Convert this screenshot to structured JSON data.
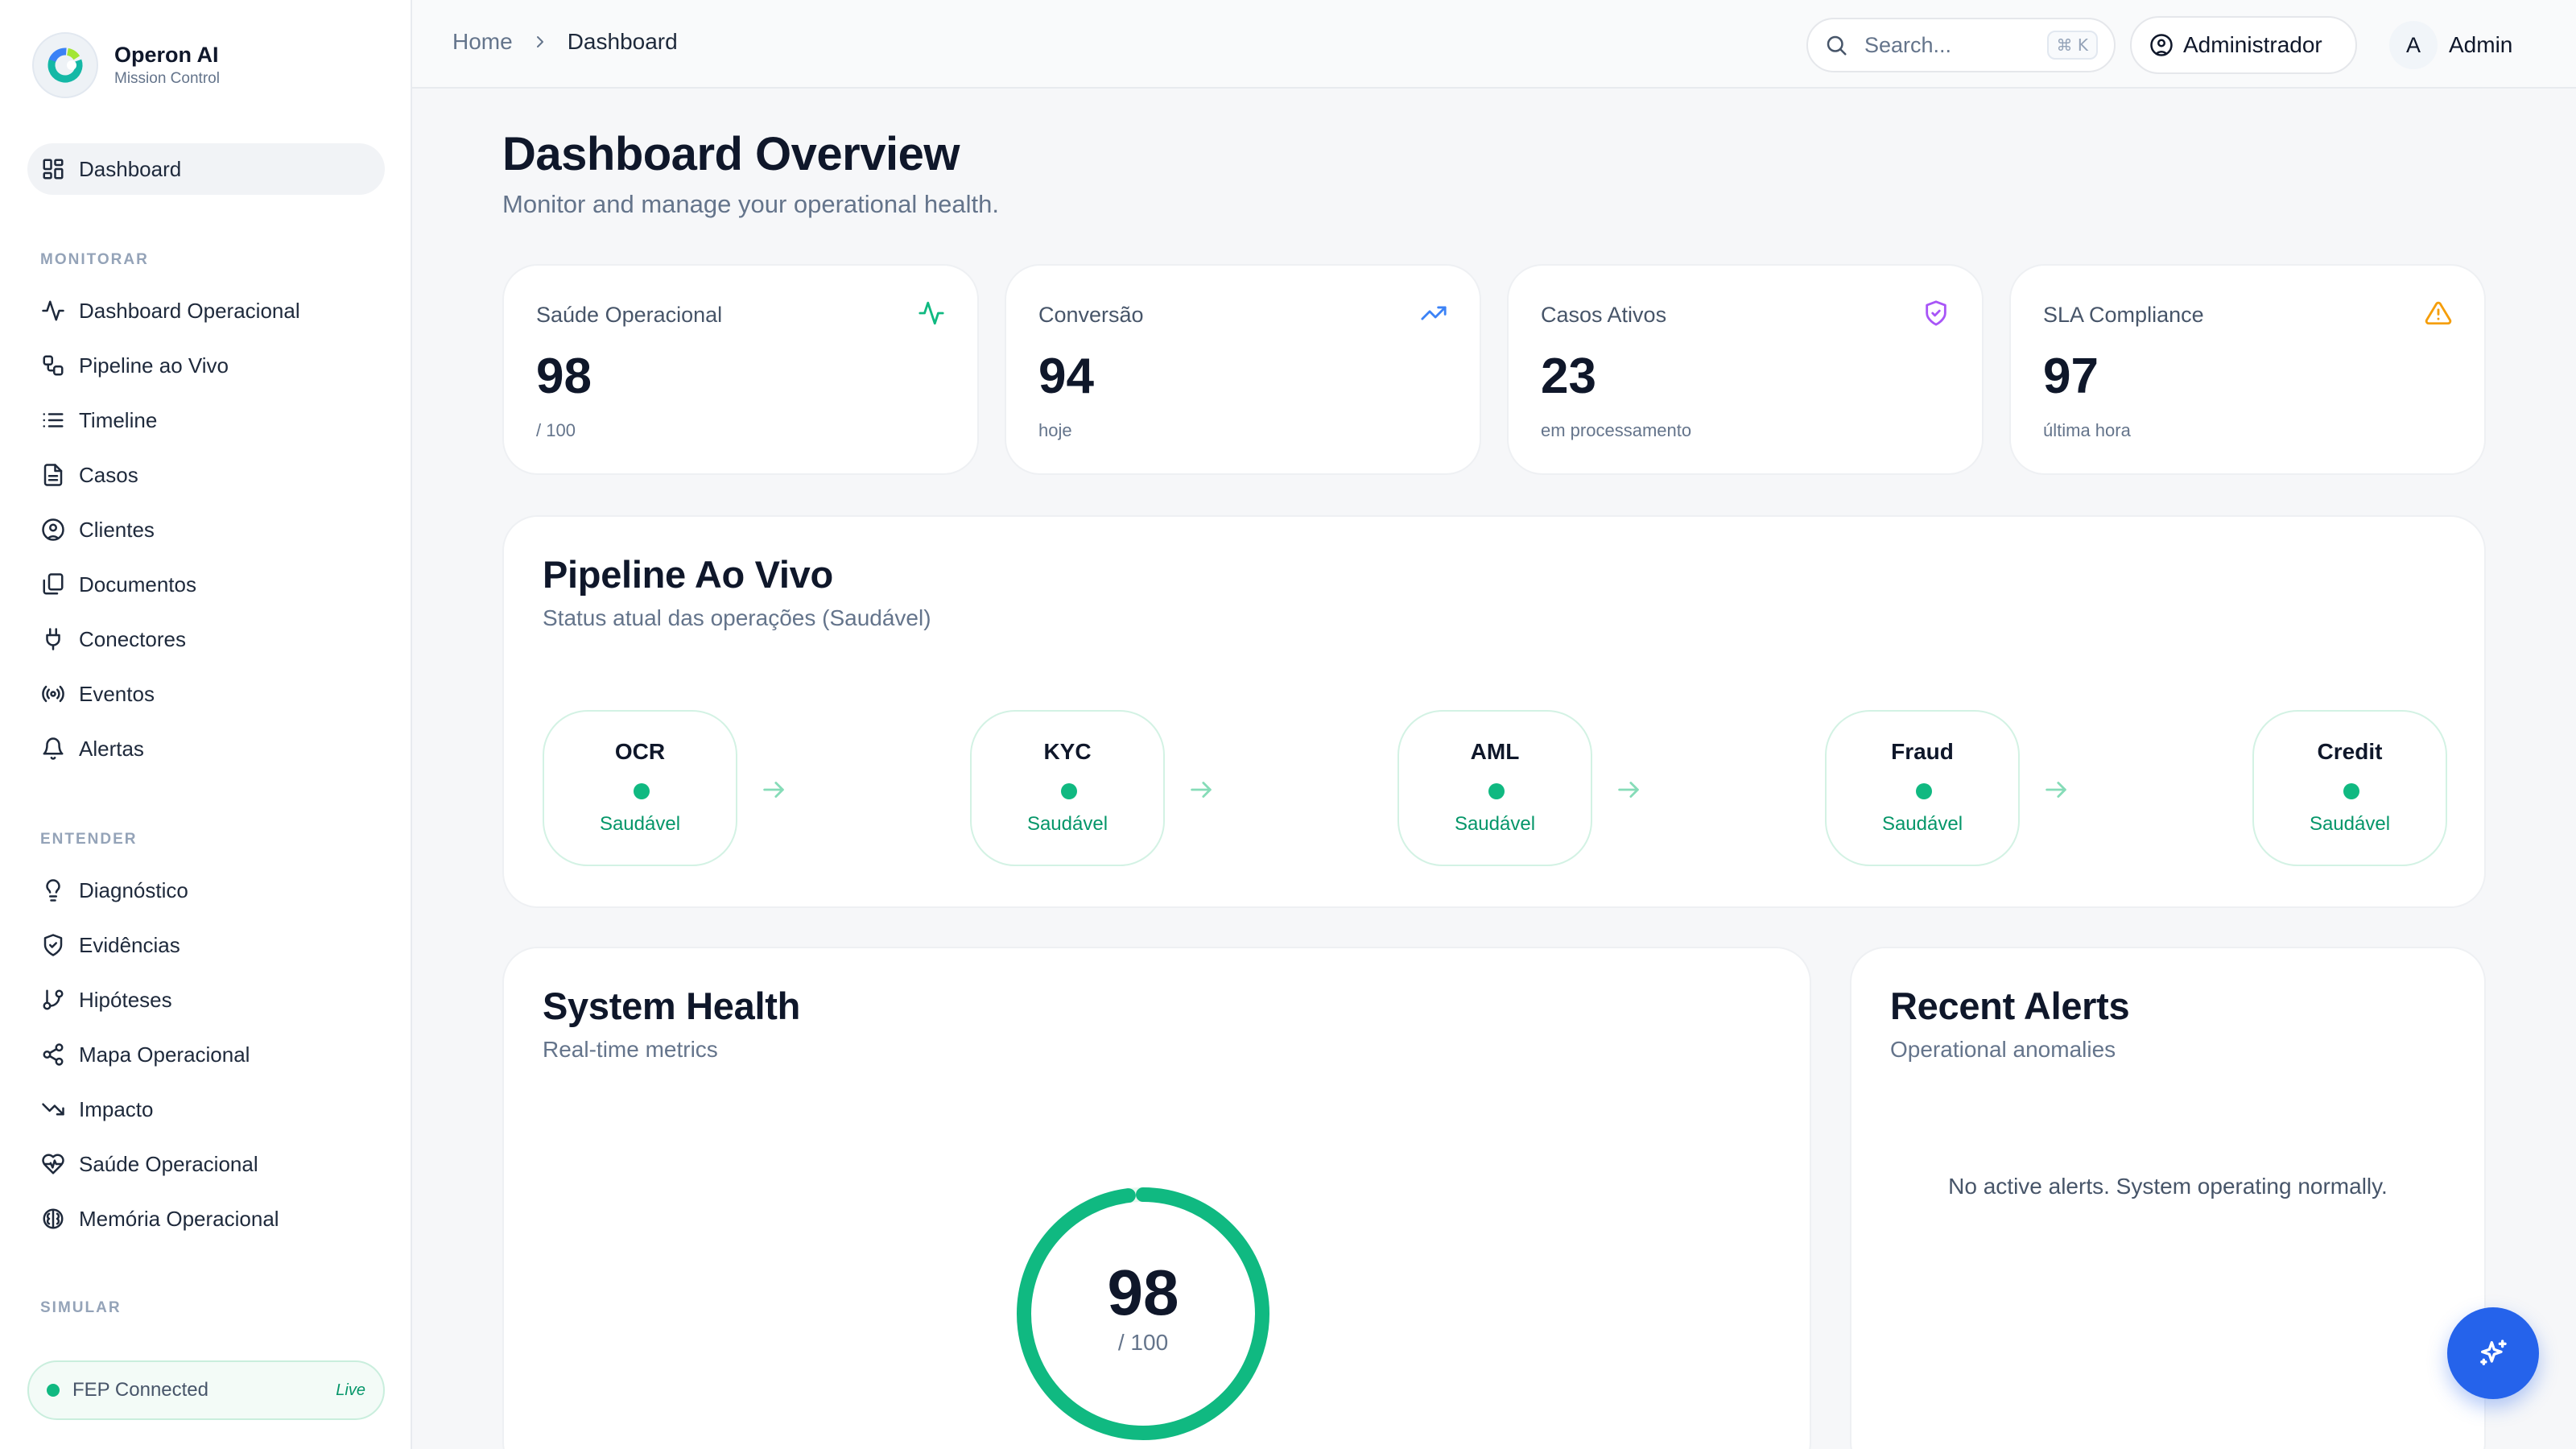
{
  "brand": {
    "name": "Operon AI",
    "subtitle": "Mission Control"
  },
  "sidebar": {
    "active": {
      "label": "Dashboard",
      "icon": "layout-grid-icon"
    },
    "sections": [
      {
        "title": "MONITORAR",
        "items": [
          {
            "label": "Dashboard Operacional",
            "icon": "activity-icon"
          },
          {
            "label": "Pipeline ao Vivo",
            "icon": "workflow-icon"
          },
          {
            "label": "Timeline",
            "icon": "list-icon"
          },
          {
            "label": "Casos",
            "icon": "file-text-icon"
          },
          {
            "label": "Clientes",
            "icon": "user-circle-icon"
          },
          {
            "label": "Documentos",
            "icon": "files-icon"
          },
          {
            "label": "Conectores",
            "icon": "plug-icon"
          },
          {
            "label": "Eventos",
            "icon": "radio-icon"
          },
          {
            "label": "Alertas",
            "icon": "bell-icon"
          }
        ]
      },
      {
        "title": "ENTENDER",
        "items": [
          {
            "label": "Diagnóstico",
            "icon": "lightbulb-icon"
          },
          {
            "label": "Evidências",
            "icon": "shield-check-icon"
          },
          {
            "label": "Hipóteses",
            "icon": "git-branch-icon"
          },
          {
            "label": "Mapa Operacional",
            "icon": "share-icon"
          },
          {
            "label": "Impacto",
            "icon": "trending-down-icon"
          },
          {
            "label": "Saúde Operacional",
            "icon": "heart-pulse-icon"
          },
          {
            "label": "Memória Operacional",
            "icon": "brain-icon"
          }
        ]
      },
      {
        "title": "SIMULAR",
        "items": []
      }
    ],
    "status": {
      "label": "FEP Connected",
      "badge": "Live"
    }
  },
  "topbar": {
    "breadcrumb": {
      "home": "Home",
      "current": "Dashboard"
    },
    "search": {
      "placeholder": "Search...",
      "shortcut": "⌘ K"
    },
    "role": "Administrador",
    "user": {
      "initial": "A",
      "name": "Admin"
    }
  },
  "page": {
    "title": "Dashboard Overview",
    "subtitle": "Monitor and manage your operational health."
  },
  "kpis": [
    {
      "title": "Saúde Operacional",
      "value": "98",
      "sub": "/ 100",
      "icon": "activity-icon",
      "color": "#10b981"
    },
    {
      "title": "Conversão",
      "value": "94",
      "sub": "hoje",
      "icon": "trending-up-icon",
      "color": "#3b82f6"
    },
    {
      "title": "Casos Ativos",
      "value": "23",
      "sub": "em processamento",
      "icon": "shield-icon",
      "color": "#a855f7"
    },
    {
      "title": "SLA Compliance",
      "value": "97",
      "sub": "última hora",
      "icon": "alert-triangle-icon",
      "color": "#f59e0b"
    }
  ],
  "pipeline": {
    "title": "Pipeline Ao Vivo",
    "subtitle": "Status atual das operações (Saudável)",
    "stages": [
      {
        "name": "OCR",
        "status": "Saudável"
      },
      {
        "name": "KYC",
        "status": "Saudável"
      },
      {
        "name": "AML",
        "status": "Saudável"
      },
      {
        "name": "Fraud",
        "status": "Saudável"
      },
      {
        "name": "Credit",
        "status": "Saudável"
      }
    ]
  },
  "system_health": {
    "title": "System Health",
    "subtitle": "Real-time metrics",
    "score": "98",
    "score_suffix": "/ 100",
    "score_fraction": 0.98
  },
  "alerts": {
    "title": "Recent Alerts",
    "subtitle": "Operational anomalies",
    "empty": "No active alerts. System operating normally."
  },
  "colors": {
    "accent": "#2563eb",
    "healthy": "#10b981",
    "healthy_text": "#059669"
  },
  "fab": {
    "icon": "sparkles-icon"
  }
}
